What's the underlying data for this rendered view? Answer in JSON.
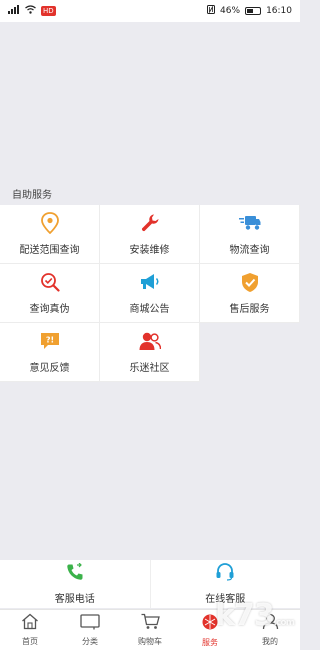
{
  "status_bar": {
    "left_badge": "HD",
    "battery": "46%",
    "time": "16:10"
  },
  "section": {
    "title": "自助服务"
  },
  "grid": [
    {
      "label": "配送范围查询",
      "icon": "location-pin-icon",
      "color": "#f0a030"
    },
    {
      "label": "安装维修",
      "icon": "wrench-icon",
      "color": "#e2322b"
    },
    {
      "label": "物流查询",
      "icon": "delivery-truck-icon",
      "color": "#3a8fd8"
    },
    {
      "label": "查询真伪",
      "icon": "verify-search-icon",
      "color": "#e2322b"
    },
    {
      "label": "商城公告",
      "icon": "megaphone-icon",
      "color": "#1f9fd6"
    },
    {
      "label": "售后服务",
      "icon": "shield-check-icon",
      "color": "#f0a030"
    },
    {
      "label": "意见反馈",
      "icon": "feedback-icon",
      "color": "#f0a030"
    },
    {
      "label": "乐迷社区",
      "icon": "community-icon",
      "color": "#e2322b"
    }
  ],
  "service_bar": {
    "phone_label": "客服电话",
    "online_label": "在线客服",
    "phone_color": "#3bb24a",
    "online_color": "#1f9fd6"
  },
  "tabs": [
    {
      "label": "首页",
      "icon": "home-icon"
    },
    {
      "label": "分类",
      "icon": "category-icon"
    },
    {
      "label": "购物车",
      "icon": "cart-icon"
    },
    {
      "label": "服务",
      "icon": "service-icon",
      "active": true
    },
    {
      "label": "我的",
      "icon": "profile-icon"
    }
  ],
  "watermark": {
    "text": "k73",
    "suffix": ".com"
  }
}
